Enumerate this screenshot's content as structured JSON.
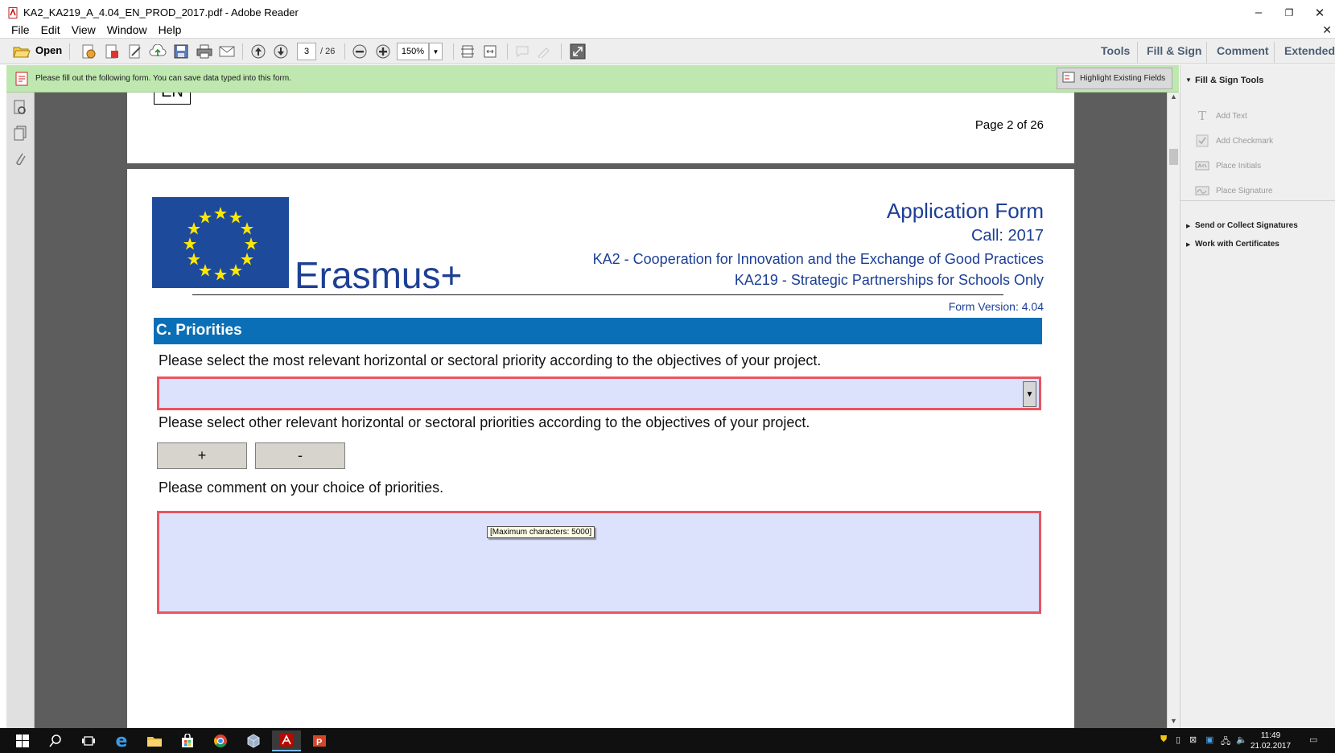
{
  "window": {
    "title": "KA2_KA219_A_4.04_EN_PROD_2017.pdf - Adobe Reader",
    "controls": [
      "–",
      "❐",
      "✕"
    ]
  },
  "menu": [
    "File",
    "Edit",
    "View",
    "Window",
    "Help"
  ],
  "toolbar": {
    "open_label": "Open",
    "page_current": "3",
    "page_total": "/ 26",
    "zoom": "150%",
    "right_tools": [
      "Tools",
      "Fill & Sign",
      "Comment",
      "Extended"
    ]
  },
  "notification": {
    "text": "Please fill out the following form. You can save data typed into this form.",
    "highlight_label": "Highlight Existing Fields"
  },
  "right_panel": {
    "header": "Fill & Sign Tools",
    "items": [
      "Add Text",
      "Add Checkmark",
      "Place Initials",
      "Place Signature"
    ],
    "sections": [
      "Send or Collect Signatures",
      "Work with Certificates"
    ]
  },
  "document": {
    "prev_page_box": "EN",
    "prev_page_number": "Page 2 of 26",
    "logo_text": "Erasmus+",
    "title": "Application Form",
    "call": "Call: 2017",
    "ka2": "KA2 - Cooperation for Innovation and the Exchange of Good Practices",
    "ka219": "KA219 - Strategic Partnerships for Schools Only",
    "form_version": "Form Version: 4.04",
    "section_title": "C. Priorities",
    "q1": "Please select the most relevant horizontal or sectoral priority according to the objectives of your project.",
    "q2": "Please select other relevant horizontal or sectoral priorities according to the objectives of your project.",
    "add_label": "+",
    "remove_label": "-",
    "q3": "Please comment on your choice of priorities.",
    "tooltip": "[Maximum characters: 5000]",
    "dropdown_value": "",
    "comment_value": ""
  },
  "taskbar": {
    "time": "11:49",
    "date": "21.02.2017"
  },
  "colors": {
    "section_bar": "#0a6fb6",
    "brand_blue": "#1c3f95",
    "field_border": "#e85560",
    "field_fill": "#dde2fc",
    "notification_bg": "#bfe8b1"
  }
}
